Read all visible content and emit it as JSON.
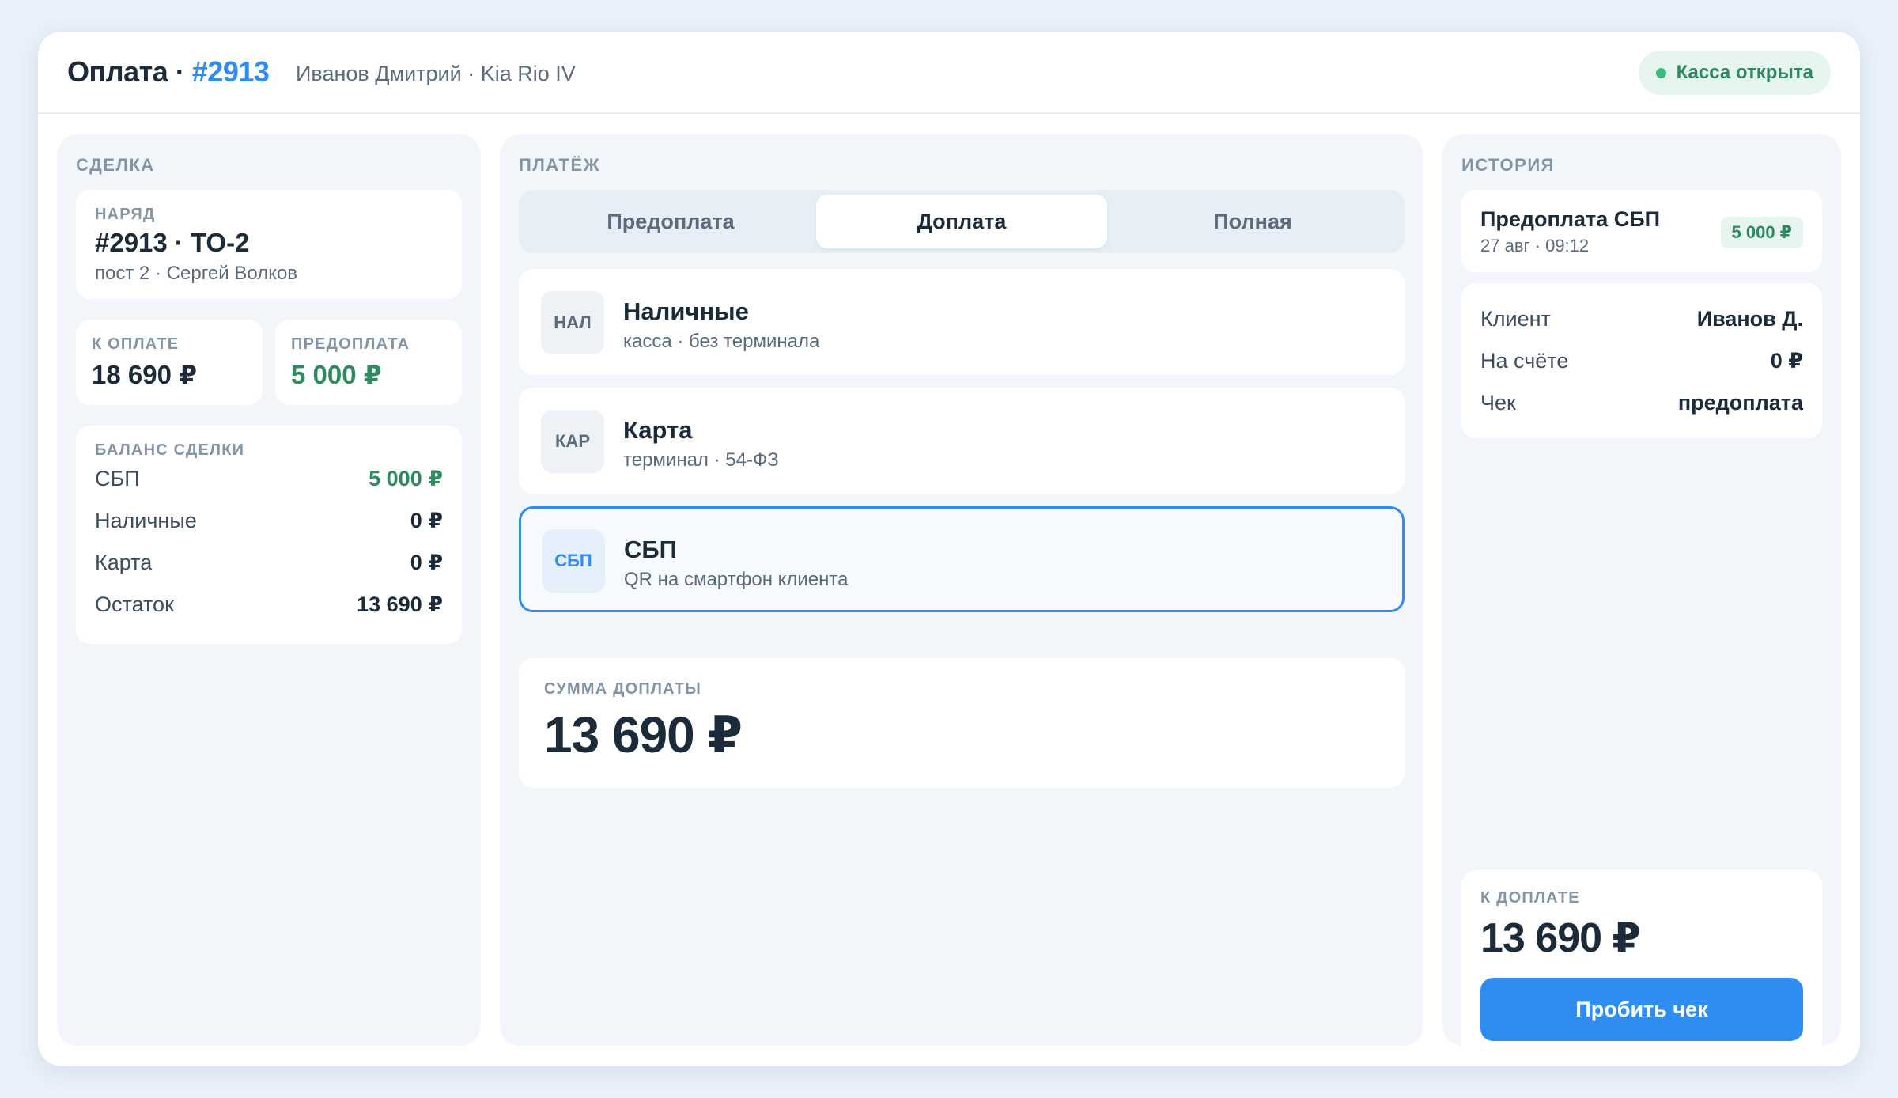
{
  "header": {
    "title_prefix": "Оплата · ",
    "title_number": "#2913",
    "subtitle": "Иванов Дмитрий · Kia Rio IV",
    "status": "Касса открыта"
  },
  "deal": {
    "label": "СДЕЛКА",
    "order": {
      "label": "НАРЯД",
      "number": "#2913 · ТО-2",
      "meta": "пост 2 · Сергей Волков"
    },
    "to_pay": {
      "label": "К ОПЛАТЕ",
      "value": "18 690 ₽"
    },
    "prepaid": {
      "label": "ПРЕДОПЛАТА",
      "value": "5 000 ₽"
    },
    "balance": {
      "label": "БАЛАНС СДЕЛКИ",
      "rows": [
        {
          "key": "СБП",
          "value": "5 000 ₽"
        },
        {
          "key": "Наличные",
          "value": "0 ₽"
        },
        {
          "key": "Карта",
          "value": "0 ₽"
        },
        {
          "key": "Остаток",
          "value": "13 690 ₽"
        }
      ]
    }
  },
  "payment": {
    "label": "ПЛАТЁЖ",
    "tabs": [
      {
        "label": "Предоплата"
      },
      {
        "label": "Доплата"
      },
      {
        "label": "Полная"
      }
    ],
    "active_tab": "Доплата",
    "methods": [
      {
        "badge": "НАЛ",
        "title": "Наличные",
        "subtitle": "касса · без терминала"
      },
      {
        "badge": "КАР",
        "title": "Карта",
        "subtitle": "терминал · 54-ФЗ"
      },
      {
        "badge": "СБП",
        "title": "СБП",
        "subtitle": "QR на смартфон клиента"
      }
    ],
    "selected_method": "СБП",
    "amount": {
      "label": "СУММА ДОПЛАТЫ",
      "value": "13 690 ₽"
    }
  },
  "history": {
    "label": "ИСТОРИЯ",
    "entry": {
      "title": "Предоплата СБП",
      "date": "27 авг · 09:12",
      "amount": "5 000 ₽"
    },
    "info": [
      {
        "key": "Клиент",
        "value": "Иванов Д."
      },
      {
        "key": "На счёте",
        "value": "0 ₽"
      },
      {
        "key": "Чек",
        "value": "предоплата"
      }
    ],
    "due": {
      "label": "К ДОПЛАТЕ",
      "value": "13 690 ₽"
    },
    "submit_label": "Пробить чек"
  },
  "colors": {
    "accent": "#2f8cf0",
    "success": "#2f8a5f",
    "background": "#e9f1fa"
  }
}
